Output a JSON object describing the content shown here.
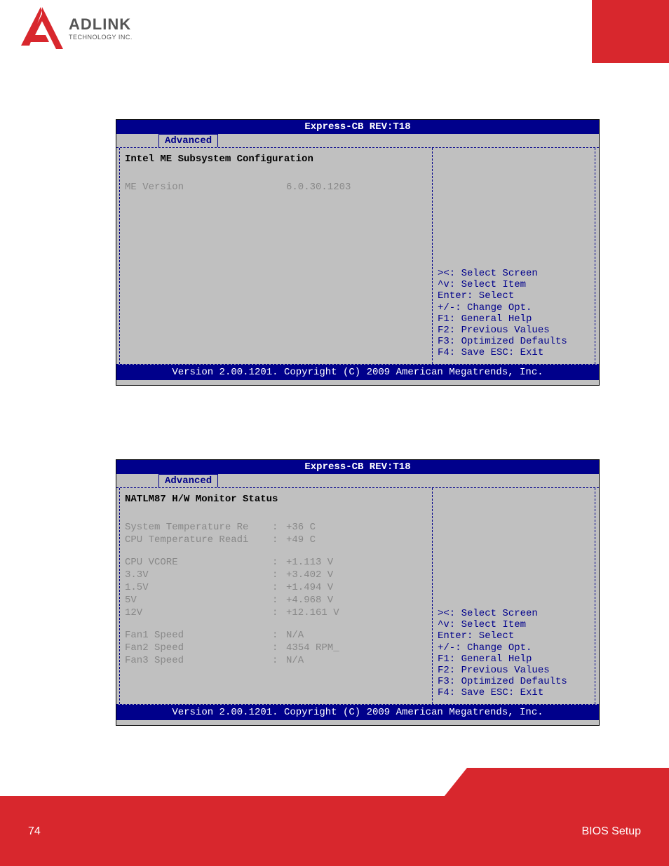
{
  "logo": {
    "brand": "ADLINK",
    "tagline": "TECHNOLOGY INC."
  },
  "sections": {
    "s1": {
      "heading": "Intel ME Subsystem"
    },
    "s2": {
      "heading": "H/W Monitor"
    }
  },
  "bios": {
    "header": "Express-CB REV:T18",
    "tab": "Advanced",
    "footer": "Version 2.00.1201. Copyright (C) 2009 American Megatrends, Inc.",
    "help": {
      "nav_screen": "><: Select Screen",
      "nav_item": "^v: Select Item",
      "enter": "Enter: Select",
      "change": "+/-: Change Opt.",
      "f1": "F1: General Help",
      "f2": "F2: Previous Values",
      "f3": "F3: Optimized Defaults",
      "f4": "F4: Save  ESC: Exit"
    }
  },
  "panel1": {
    "title": "Intel ME Subsystem Configuration",
    "rows": {
      "me_version": {
        "label": "ME Version",
        "value": "6.0.30.1203"
      }
    }
  },
  "panel2": {
    "title": "NATLM87 H/W Monitor Status",
    "rows": {
      "sys_temp": {
        "label": "System Temperature Re",
        "value": "+36 C"
      },
      "cpu_temp": {
        "label": "CPU Temperature Readi",
        "value": "+49 C"
      },
      "cpu_vcore": {
        "label": "CPU VCORE",
        "value": "+1.113 V"
      },
      "v33": {
        "label": "3.3V",
        "value": "+3.402 V"
      },
      "v15": {
        "label": "1.5V",
        "value": "+1.494 V"
      },
      "v5": {
        "label": "5V",
        "value": "+4.968 V"
      },
      "v12": {
        "label": "12V",
        "value": "+12.161 V"
      },
      "fan1": {
        "label": "Fan1 Speed",
        "value": "N/A"
      },
      "fan2": {
        "label": "Fan2 Speed",
        "value": "4354 RPM_"
      },
      "fan3": {
        "label": "Fan3 Speed",
        "value": "N/A"
      }
    }
  },
  "footer": {
    "page": "74",
    "section": "BIOS Setup"
  }
}
